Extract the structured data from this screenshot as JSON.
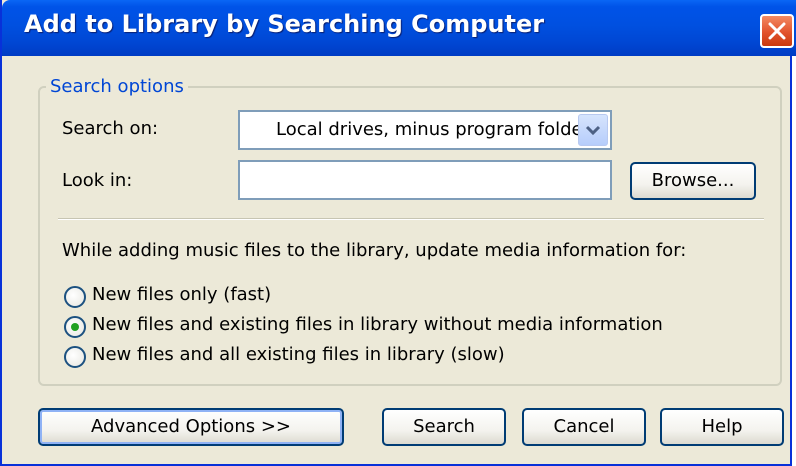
{
  "window": {
    "title": "Add to Library by Searching Computer"
  },
  "search_options": {
    "legend": "Search options",
    "search_on_label": "Search on:",
    "search_on_value": "Local drives, minus program folders",
    "look_in_label": "Look in:",
    "look_in_value": "",
    "browse_label": "Browse..."
  },
  "update_section": {
    "prompt": "While adding music files to the library, update media information for:",
    "options": [
      {
        "label": "New files only (fast)",
        "selected": false
      },
      {
        "label": "New files and existing files in library without media information",
        "selected": true
      },
      {
        "label": "New files and all existing files in library (slow)",
        "selected": false
      }
    ]
  },
  "buttons": {
    "advanced": "Advanced Options >>",
    "search": "Search",
    "cancel": "Cancel",
    "help": "Help"
  },
  "colors": {
    "title_bar": "#0050e0",
    "dialog_bg": "#ece9d8",
    "legend_text": "#0046d5",
    "close_button": "#e2532c",
    "radio_dot": "#21a121"
  },
  "icons": {
    "close": "close-icon",
    "dropdown": "chevron-down-icon"
  }
}
